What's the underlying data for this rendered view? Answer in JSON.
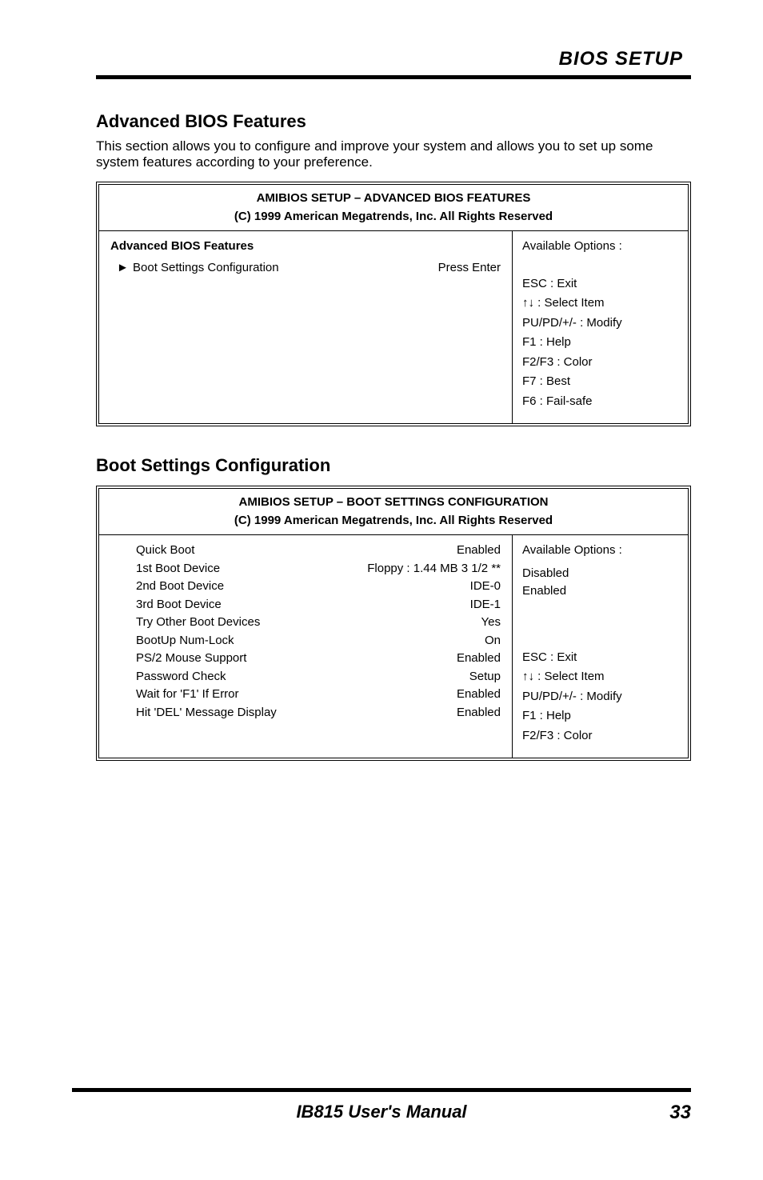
{
  "header": {
    "title": "BIOS SETUP"
  },
  "section": {
    "heading": "Advanced BIOS Features",
    "desc": "This section allows you to configure and improve your system and allows you to set up some system features according to your preference."
  },
  "bios1": {
    "title": "AMIBIOS SETUP – ADVANCED BIOS FEATURES",
    "copyright": "(C) 1999 American Megatrends, Inc. All Rights Reserved",
    "rows": [
      {
        "marker": "►",
        "label": "Boot Settings Configuration",
        "value": "Press Enter"
      }
    ],
    "help": {
      "title": "Available Options :",
      "lines": [
        "ESC : Exit",
        "↑↓ : Select Item",
        "PU/PD/+/- : Modify",
        "F1 : Help",
        "F2/F3 : Color",
        "F7 : Best",
        "F6 : Fail-safe"
      ]
    }
  },
  "second_heading": "Boot Settings Configuration",
  "bios2": {
    "title": "AMIBIOS SETUP – BOOT SETTINGS CONFIGURATION",
    "copyright": "(C) 1999 American Megatrends, Inc. All Rights Reserved",
    "rows": [
      {
        "label": "Quick Boot",
        "value": "Enabled"
      },
      {
        "label": "1st Boot Device",
        "value": "Floppy : 1.44 MB 3 1/2 **"
      },
      {
        "label": "2nd Boot Device",
        "value": "IDE-0"
      },
      {
        "label": "3rd Boot Device",
        "value": "IDE-1"
      },
      {
        "label": "Try Other Boot Devices",
        "value": "Yes"
      },
      {
        "label": "BootUp Num-Lock",
        "value": "On"
      },
      {
        "label": "PS/2 Mouse Support",
        "value": "Enabled"
      },
      {
        "label": "Password Check",
        "value": "Setup"
      },
      {
        "label": "Wait for 'F1' If Error",
        "value": "Enabled"
      },
      {
        "label": "Hit 'DEL' Message Display",
        "value": "Enabled"
      }
    ],
    "help": {
      "title": "Available Options :",
      "opt1": "Disabled",
      "opt2": "Enabled",
      "lines": [
        "ESC : Exit",
        "↑↓ : Select Item",
        "PU/PD/+/- : Modify",
        "F1 : Help",
        "F2/F3 : Color"
      ]
    }
  },
  "footer": {
    "center": "IB815 User's Manual",
    "page": "33"
  }
}
